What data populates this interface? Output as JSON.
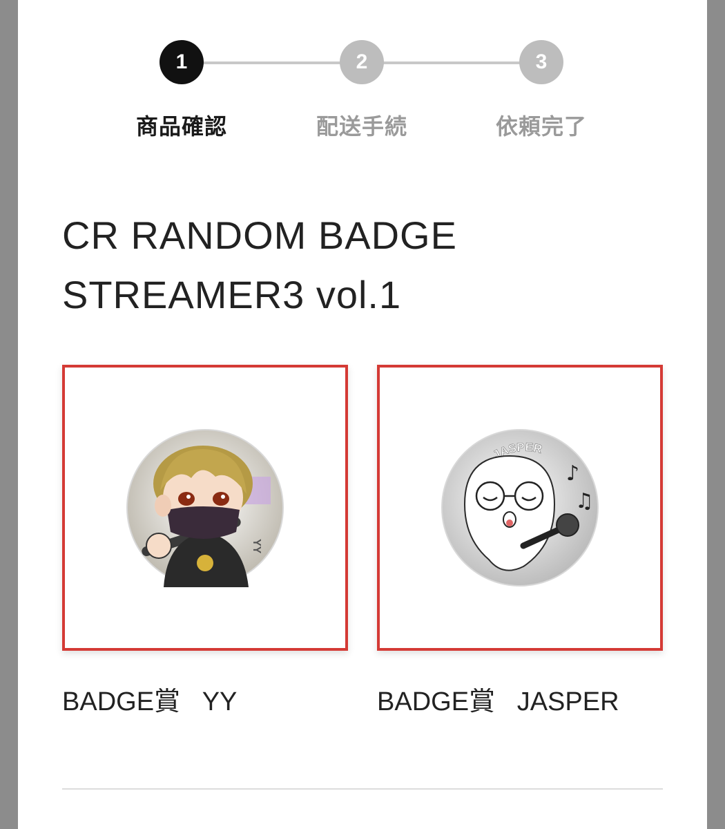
{
  "stepper": {
    "steps": [
      {
        "number": "1",
        "label": "商品確認",
        "state": "active"
      },
      {
        "number": "2",
        "label": "配送手続",
        "state": "inactive"
      },
      {
        "number": "3",
        "label": "依頼完了",
        "state": "inactive"
      }
    ]
  },
  "product": {
    "title_line1": "CR RANDOM BADGE",
    "title_line2": "STREAMER3 vol.1"
  },
  "prizes": [
    {
      "label": "BADGE賞   YY",
      "badge_text": "YY",
      "icon": "masked-character-badge"
    },
    {
      "label": "BADGE賞   JASPER",
      "badge_text": "JASPER",
      "icon": "singing-character-badge"
    }
  ],
  "colors": {
    "accent_border": "#d43a35",
    "active_step": "#111111",
    "inactive_step": "#bdbdbd"
  }
}
